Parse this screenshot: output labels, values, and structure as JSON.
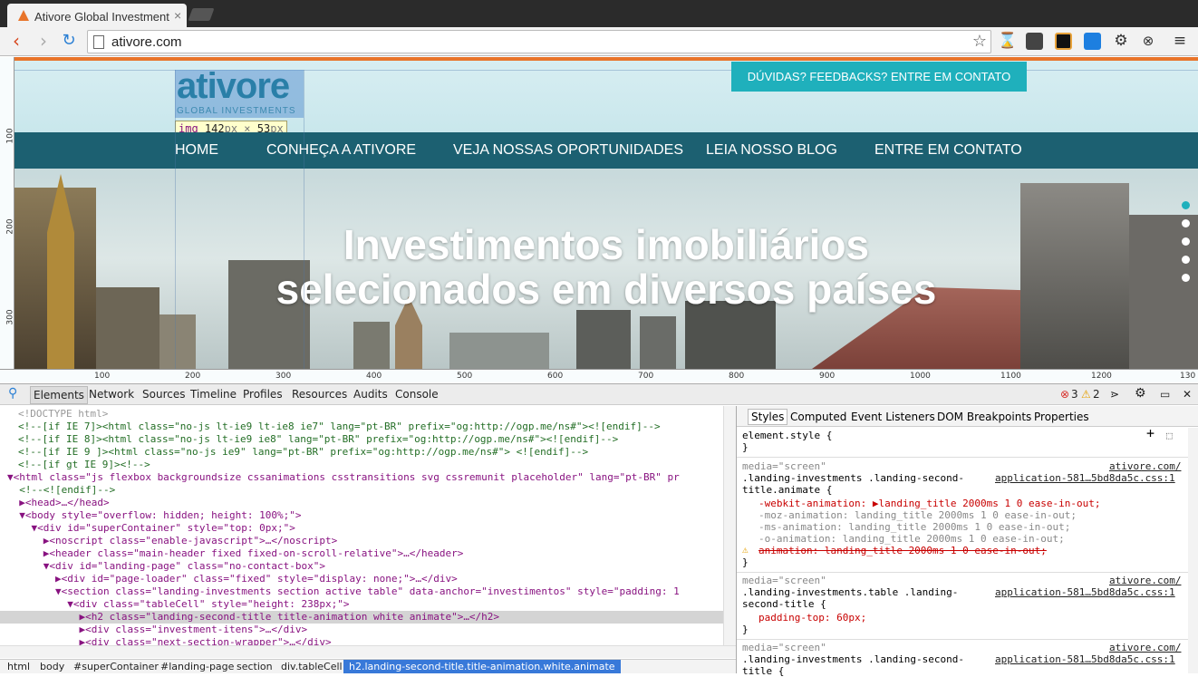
{
  "browser": {
    "tab_title": "Ativore Global Investment",
    "url": "ativore.com"
  },
  "page": {
    "logo_main": "ativore",
    "logo_sub": "GLOBAL INVESTMENTS",
    "dim_tip_tag": "img",
    "dim_tip_w": "142",
    "dim_tip_h": "53",
    "dim_tip_unit": "px",
    "dim_tip_x": "×",
    "contact_button": "DÚVIDAS? FEEDBACKS? ENTRE EM CONTATO",
    "nav": [
      "HOME",
      "CONHEÇA A ATIVORE",
      "VEJA NOSSAS OPORTUNIDADES",
      "LEIA NOSSO BLOG",
      "ENTRE EM CONTATO"
    ],
    "hero_line1": "Investimentos imobiliários",
    "hero_line2": "selecionados em diversos países",
    "ruler_top": [
      "100",
      "200",
      "300",
      "400",
      "500",
      "600",
      "700",
      "800",
      "900",
      "1000",
      "1100",
      "1200",
      "130"
    ],
    "ruler_left": [
      "100",
      "200",
      "300"
    ]
  },
  "devtools": {
    "tabs": [
      "Elements",
      "Network",
      "Sources",
      "Timeline",
      "Profiles",
      "Resources",
      "Audits",
      "Console"
    ],
    "errors": "3",
    "warnings": "2",
    "dom_lines": [
      "<!DOCTYPE html>",
      "<!--[if IE 7]><html class=\"no-js lt-ie9 lt-ie8 ie7\" lang=\"pt-BR\" prefix=\"og:http://ogp.me/ns#\"><![endif]-->",
      "<!--[if IE 8]><html class=\"no-js lt-ie9 ie8\" lang=\"pt-BR\" prefix=\"og:http://ogp.me/ns#\"><![endif]-->",
      "<!--[if IE 9 ]><html class=\"no-js ie9\" lang=\"pt-BR\" prefix=\"og:http://ogp.me/ns#\"> <![endif]-->",
      "<!--[if gt IE 9]><!-->",
      "▼<html class=\"js flexbox backgroundsize cssanimations csstransitions svg cssremunit placeholder\" lang=\"pt-BR\" pr",
      "  <!--<![endif]-->",
      "  ▶<head>…</head>",
      "  ▼<body style=\"overflow: hidden; height: 100%;\">",
      "    ▼<div id=\"superContainer\" style=\"top: 0px;\">",
      "      ▶<noscript class=\"enable-javascript\">…</noscript>",
      "      ▶<header class=\"main-header fixed fixed-on-scroll-relative\">…</header>",
      "      ▼<div id=\"landing-page\" class=\"no-contact-box\">",
      "        ▶<div id=\"page-loader\" class=\"fixed\" style=\"display: none;\">…</div>",
      "        ▼<section class=\"landing-investments section active table\" data-anchor=\"investimentos\" style=\"padding: 1",
      "          ▼<div class=\"tableCell\" style=\"height: 238px;\">",
      "            ▶<h2 class=\"landing-second-title title-animation white animate\">…</h2>",
      "            ▶<div class=\"investment-itens\">…</div>",
      "            ▶<div class=\"next-section-wrapper\">…</div>"
    ],
    "breadcrumbs": [
      "html",
      "body",
      "#superContainer",
      "#landing-page",
      "section",
      "div.tableCell",
      "h2.landing-second-title.title-animation.white.animate"
    ],
    "styles_tabs": [
      "Styles",
      "Computed",
      "Event Listeners",
      "DOM Breakpoints",
      "Properties"
    ],
    "styles": {
      "element_style": "element.style {",
      "close": "}",
      "media": "media=\"screen\"",
      "source_site": "ativore.com/",
      "source_file": "application-581…5bd8da5c.css:1",
      "rule1_sel_a": ".landing-investments .landing-second-",
      "rule1_sel_b": "title.animate {",
      "rule1_props": [
        "-webkit-animation: ▶landing_title 2000ms 1 0 ease-in-out;",
        "-moz-animation: landing_title 2000ms 1 0 ease-in-out;",
        "-ms-animation: landing_title 2000ms 1 0 ease-in-out;",
        "-o-animation: landing_title 2000ms 1 0 ease-in-out;",
        "animation: landing_title 2000ms 1 0 ease-in-out;"
      ],
      "rule2_sel_a": ".landing-investments.table .landing-",
      "rule2_sel_b": "second-title {",
      "rule2_prop": "padding-top: 60px;",
      "rule3_sel_a": ".landing-investments .landing-second-",
      "rule3_sel_b": "title {"
    }
  },
  "colors": {
    "accent_teal": "#1fb0bc",
    "nav_bar": "#1c6071",
    "selection": "#3879d9"
  }
}
